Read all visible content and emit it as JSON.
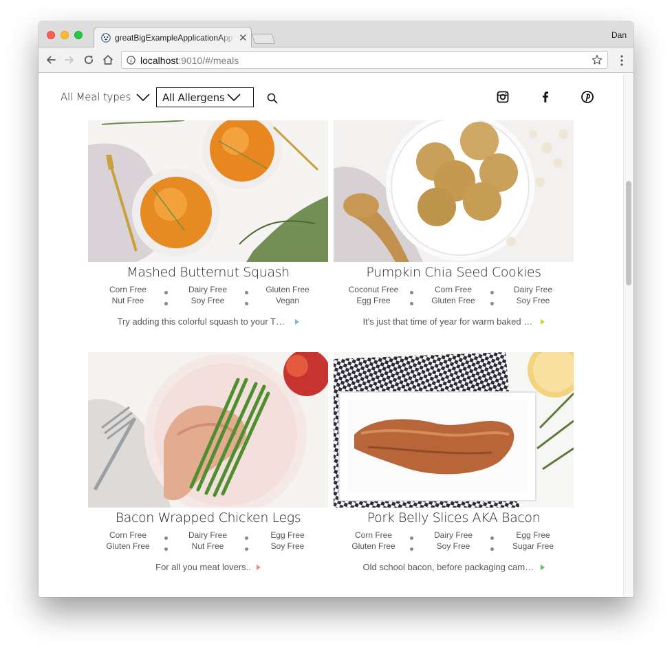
{
  "browser": {
    "tab_title": "greatBigExampleApplicationApp",
    "profile_name": "Dan",
    "url_host": "localhost",
    "url_rest": ":9010/#/meals"
  },
  "filters": {
    "meal_type_label": "All Meal types",
    "allergen_label": "All Allergens"
  },
  "meals": [
    {
      "title": "Mashed Butternut Squash",
      "tags": [
        "Corn Free",
        "Dairy Free",
        "Gluten Free",
        "Nut Free",
        "Soy Free",
        "Vegan"
      ],
      "description": "Try adding this colorful squash to your Thanksgiving table",
      "arrow_color": "#6fb8d6"
    },
    {
      "title": "Pumpkin Chia Seed Cookies",
      "tags": [
        "Coconut Free",
        "Corn Free",
        "Dairy Free",
        "Egg Free",
        "Gluten Free",
        "Soy Free"
      ],
      "description": "It's just that time of year for warm baked goods",
      "arrow_color": "#c9d12b"
    },
    {
      "title": "Bacon Wrapped Chicken Legs",
      "tags": [
        "Corn Free",
        "Dairy Free",
        "Egg Free",
        "Gluten Free",
        "Nut Free",
        "Soy Free"
      ],
      "description": "For all you meat lovers..",
      "arrow_color": "#f08a86"
    },
    {
      "title": "Pork Belly Slices AKA Bacon",
      "tags": [
        "Corn Free",
        "Dairy Free",
        "Egg Free",
        "Gluten Free",
        "Soy Free",
        "Sugar Free"
      ],
      "description": "Old school bacon, before packaging came along",
      "arrow_color": "#5cc35a"
    }
  ],
  "icons": {
    "favicon": "dog-face-icon",
    "social": [
      "instagram-icon",
      "facebook-icon",
      "pinterest-icon"
    ]
  }
}
